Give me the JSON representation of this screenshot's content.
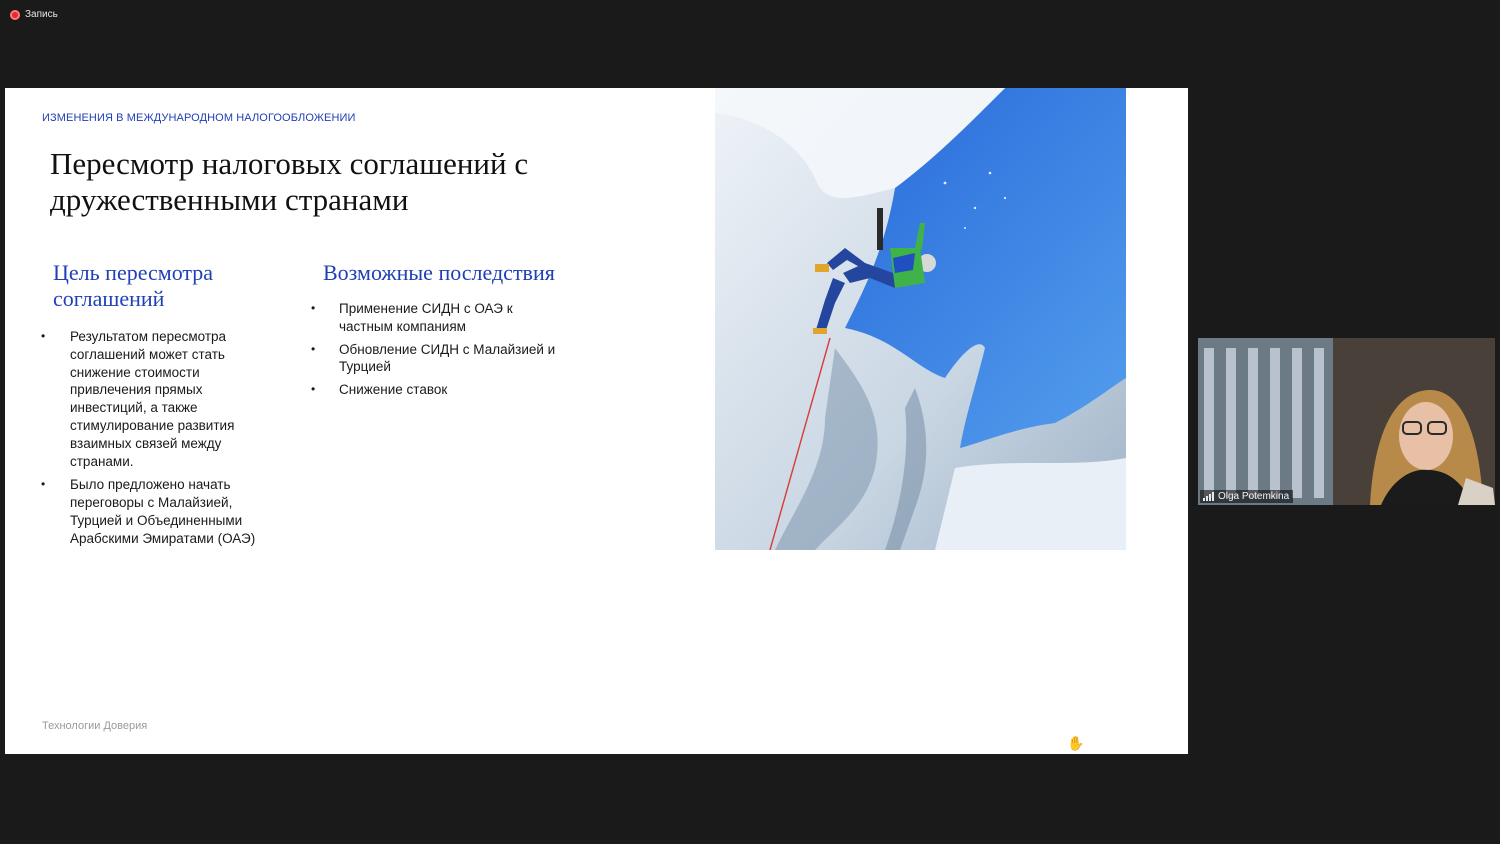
{
  "recording": {
    "label": "Запись"
  },
  "slide": {
    "kicker": "ИЗМЕНЕНИЯ В МЕЖДУНАРОДНОМ НАЛОГООБЛОЖЕНИИ",
    "title": "Пересмотр налоговых соглашений с дружественными странами",
    "left_column": {
      "heading": "Цель пересмотра соглашений",
      "bullets": [
        "Результатом пересмотра соглашений может стать снижение стоимости привлечения прямых инвестиций, а также стимулирование развития взаимных связей между странами.",
        "Было предложено начать переговоры с Малайзией, Турцией и Объединенными Арабскими Эмиратами (ОАЭ)"
      ]
    },
    "right_column": {
      "heading": "Возможные последствия",
      "bullets": [
        "Применение СИДН с ОАЭ к частным компаниям",
        "Обновление СИДН с Малайзией и Турцией",
        "Снижение ставок"
      ]
    },
    "footer": "Технологии Доверия",
    "image_icon": "ice-climber-photo",
    "accent_color": "#1f3fb5"
  },
  "video_tile": {
    "participant_name": "Olga Potemkina",
    "signal_icon": "signal-bars-icon"
  },
  "cursor_icon": "hand-cursor-icon"
}
